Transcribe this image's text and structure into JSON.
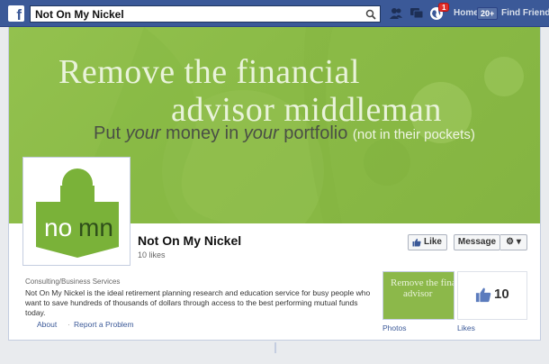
{
  "topbar": {
    "logo": "f",
    "search_value": "Not On My Nickel",
    "notification_count": "1",
    "home_label": "Home",
    "home_count": "20+",
    "find_friends_label": "Find Friends"
  },
  "cover": {
    "line1": "Remove the financial",
    "line2": "advisor middleman",
    "line3_a": "Put ",
    "line3_b": "your",
    "line3_c": " money in ",
    "line3_d": "your",
    "line3_e": " portfolio ",
    "line3_paren": "(not in their pockets)"
  },
  "profile": {
    "logo_text_no": "no",
    "logo_text_mn": "mn"
  },
  "page": {
    "name": "Not On My Nickel",
    "likes_text": "10 likes"
  },
  "actions": {
    "like_label": "Like",
    "message_label": "Message",
    "gear_label": "⚙ ▾"
  },
  "about": {
    "category": "Consulting/Business Services",
    "description": "Not On My Nickel is the ideal retirement planning research and education service for busy people who want to save hundreds of thousands of dollars through access to the best performing mutual funds today.",
    "about_link": "About",
    "separator": "·",
    "report_link": "Report a Problem"
  },
  "apps": {
    "photos_thumb_line1": "Remove the fina",
    "photos_thumb_line2": "advisor",
    "photos_label": "Photos",
    "likes_count": "10",
    "likes_label": "Likes"
  },
  "colors": {
    "facebook_blue": "#3b5998",
    "cover_green": "#8bbb47",
    "logo_green": "#7ab239"
  }
}
